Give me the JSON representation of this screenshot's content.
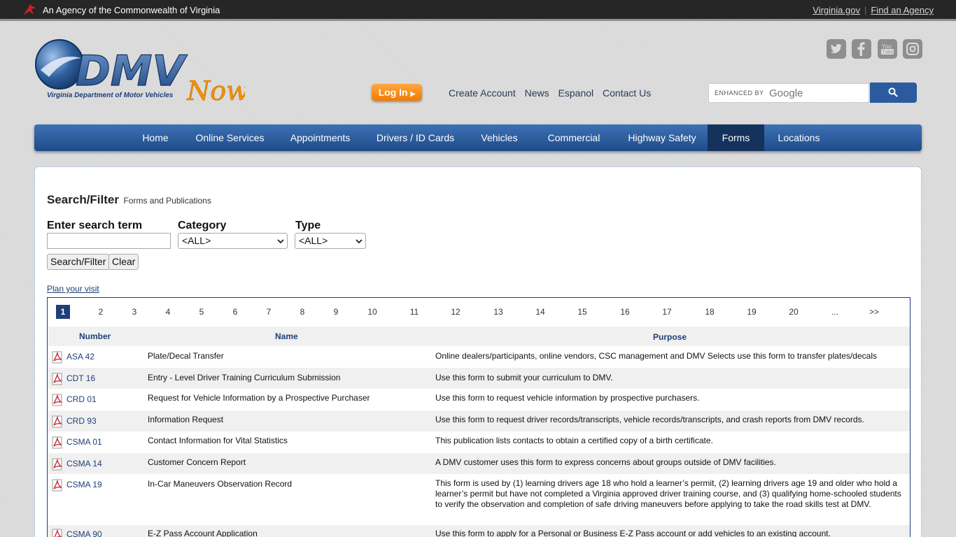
{
  "topbar": {
    "agency": "An Agency of the Commonwealth of Virginia",
    "link1": "Virginia.gov",
    "link2": "Find an Agency"
  },
  "logo": {
    "main": "DMV",
    "script": "Now",
    "tagline": "Virginia Department of Motor Vehicles"
  },
  "header": {
    "login": "Log In",
    "links": [
      "Create Account",
      "News",
      "Espanol",
      "Contact Us"
    ],
    "search_enhanced": "ENHANCED BY",
    "search_brand": "Google"
  },
  "social_icons": [
    "twitter-icon",
    "facebook-icon",
    "youtube-icon",
    "instagram-icon"
  ],
  "nav": {
    "items": [
      "Home",
      "Online Services",
      "Appointments",
      "Drivers / ID Cards",
      "Vehicles",
      "Commercial",
      "Highway Safety",
      "Forms",
      "Locations"
    ],
    "active": "Forms"
  },
  "page": {
    "title": "Search/Filter",
    "subtitle": "Forms and Publications",
    "search_label": "Enter search term",
    "search_value": "",
    "category_label": "Category",
    "category_value": "<ALL>",
    "type_label": "Type",
    "type_value": "<ALL>",
    "search_button": "Search/Filter",
    "clear_button": "Clear",
    "plan_link": "Plan your visit"
  },
  "pagination": [
    "1",
    "2",
    "3",
    "4",
    "5",
    "6",
    "7",
    "8",
    "9",
    "10",
    "11",
    "12",
    "13",
    "14",
    "15",
    "16",
    "17",
    "18",
    "19",
    "20",
    "...",
    ">>"
  ],
  "table": {
    "headers": [
      "Number",
      "Name",
      "Purpose"
    ],
    "rows": [
      {
        "number": "ASA 42",
        "name": "Plate/Decal Transfer",
        "purpose": "Online dealers/participants, online vendors, CSC management and DMV Selects use this form to transfer plates/decals"
      },
      {
        "number": "CDT 16",
        "name": "Entry - Level Driver Training Curriculum Submission",
        "purpose": "Use this form to submit your curriculum to DMV."
      },
      {
        "number": "CRD 01",
        "name": "Request for Vehicle Information by a Prospective Purchaser",
        "purpose": "Use this form to request vehicle information by prospective purchasers."
      },
      {
        "number": "CRD 93",
        "name": "Information Request",
        "purpose": "Use this form to request driver records/transcripts, vehicle records/transcripts, and crash reports from DMV records."
      },
      {
        "number": "CSMA 01",
        "name": "Contact Information for Vital Statistics",
        "purpose": "This publication lists contacts to obtain a certified copy of a birth certificate."
      },
      {
        "number": "CSMA 14",
        "name": "Customer Concern Report",
        "purpose": "A DMV customer uses this form to express concerns about groups outside of DMV facilities."
      },
      {
        "number": "CSMA 19",
        "name": "In-Car Maneuvers Observation Record",
        "purpose": "This form is used by (1) learning drivers age 18 who hold a learner’s permit, (2) learning drivers age 19 and older who hold a learner’s permit but have not completed a Virginia approved driver training course, and (3) qualifying home-schooled students to verify the observation and completion of safe driving maneuvers before applying to take the road skills test at DMV."
      },
      {
        "number": "CSMA 90",
        "name": "E-Z Pass Account Application",
        "purpose": "Use this form to apply for a Personal or Business E-Z Pass account or add vehicles to an existing account."
      }
    ]
  }
}
